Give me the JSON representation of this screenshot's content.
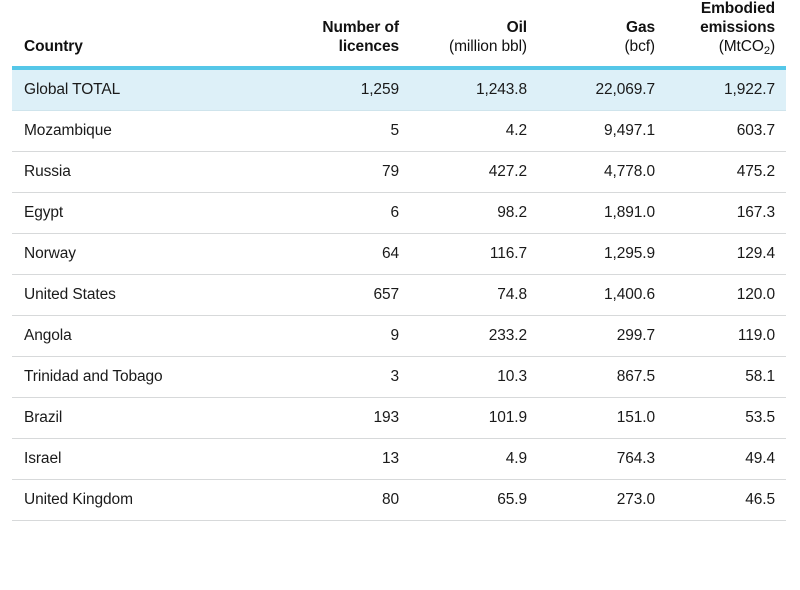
{
  "table": {
    "columns": [
      {
        "key": "country",
        "label": "Country",
        "unit": "",
        "align": "left"
      },
      {
        "key": "licences",
        "label": "Number of licences",
        "label_line1": "Number of",
        "label_line2": "licences",
        "unit": "",
        "align": "right"
      },
      {
        "key": "oil",
        "label": "Oil",
        "unit": "(million bbl)",
        "align": "right"
      },
      {
        "key": "gas",
        "label": "Gas",
        "unit": "(bcf)",
        "align": "right"
      },
      {
        "key": "emissions",
        "label_line1": "Embodied",
        "label_line2": "emissions",
        "label": "Embodied emissions",
        "unit_pre": "(MtCO",
        "unit_sub": "2",
        "unit_post": ")",
        "unit": "(MtCO2)",
        "align": "right"
      }
    ],
    "rows": [
      {
        "country": "Global TOTAL",
        "licences": "1,259",
        "oil": "1,243.8",
        "gas": "22,069.7",
        "emissions": "1,922.7",
        "highlight": true
      },
      {
        "country": "Mozambique",
        "licences": "5",
        "oil": "4.2",
        "gas": "9,497.1",
        "emissions": "603.7",
        "highlight": false
      },
      {
        "country": "Russia",
        "licences": "79",
        "oil": "427.2",
        "gas": "4,778.0",
        "emissions": "475.2",
        "highlight": false
      },
      {
        "country": "Egypt",
        "licences": "6",
        "oil": "98.2",
        "gas": "1,891.0",
        "emissions": "167.3",
        "highlight": false
      },
      {
        "country": "Norway",
        "licences": "64",
        "oil": "116.7",
        "gas": "1,295.9",
        "emissions": "129.4",
        "highlight": false
      },
      {
        "country": "United States",
        "licences": "657",
        "oil": "74.8",
        "gas": "1,400.6",
        "emissions": "120.0",
        "highlight": false
      },
      {
        "country": "Angola",
        "licences": "9",
        "oil": "233.2",
        "gas": "299.7",
        "emissions": "119.0",
        "highlight": false
      },
      {
        "country": "Trinidad and Tobago",
        "licences": "3",
        "oil": "10.3",
        "gas": "867.5",
        "emissions": "58.1",
        "highlight": false
      },
      {
        "country": "Brazil",
        "licences": "193",
        "oil": "101.9",
        "gas": "151.0",
        "emissions": "53.5",
        "highlight": false
      },
      {
        "country": "Israel",
        "licences": "13",
        "oil": "4.9",
        "gas": "764.3",
        "emissions": "49.4",
        "highlight": false
      },
      {
        "country": "United Kingdom",
        "licences": "80",
        "oil": "65.9",
        "gas": "273.0",
        "emissions": "46.5",
        "highlight": false
      }
    ]
  },
  "colors": {
    "accent_line": "#55c7e8",
    "highlight_row": "#ddf0f8",
    "row_separator": "#d7d9da",
    "text": "#1a1a1a",
    "background": "#ffffff"
  }
}
